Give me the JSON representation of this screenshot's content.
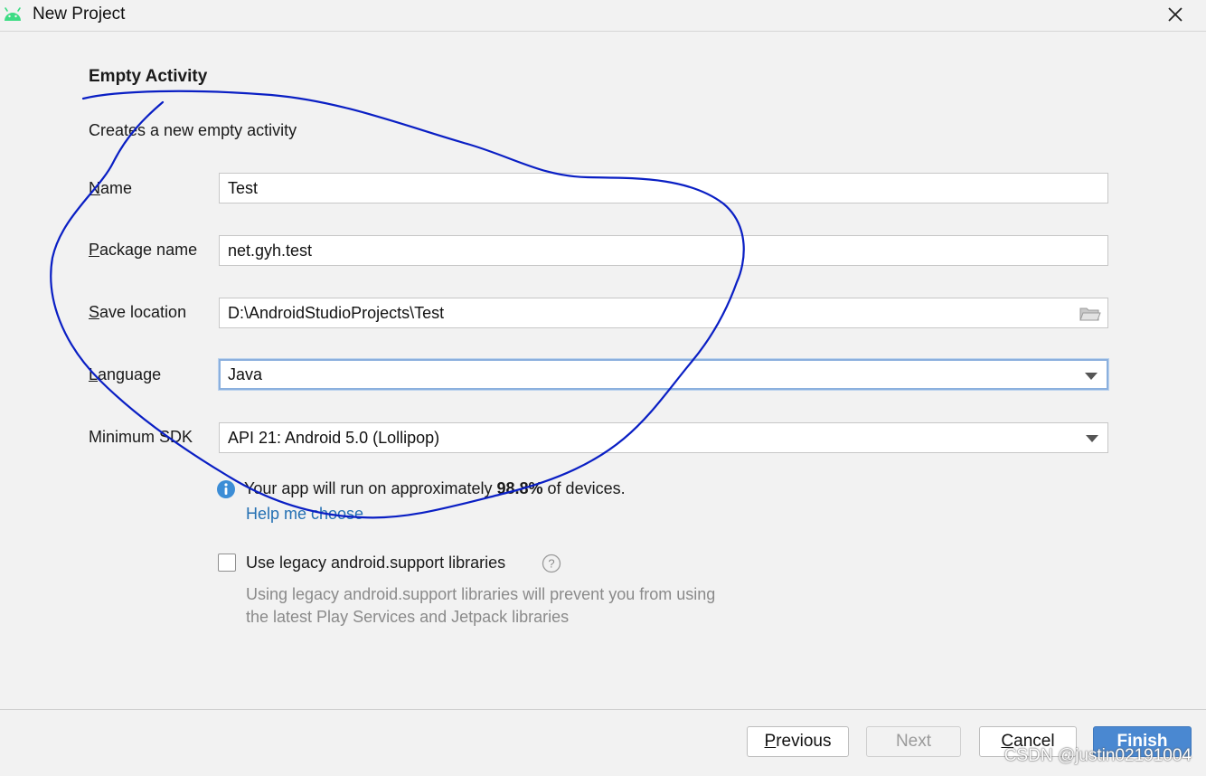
{
  "window": {
    "title": "New Project"
  },
  "template": {
    "heading": "Empty Activity",
    "description": "Creates a new empty activity"
  },
  "form": {
    "name": {
      "label_mnemonic": "N",
      "label_rest": "ame",
      "value": "Test"
    },
    "package": {
      "label_mnemonic": "P",
      "label_rest": "ackage name",
      "value": "net.gyh.test"
    },
    "save_location": {
      "label_mnemonic": "S",
      "label_rest": "ave location",
      "value": "D:\\AndroidStudioProjects\\Test"
    },
    "language": {
      "label_mnemonic": "L",
      "label_rest": "anguage",
      "value": "Java"
    },
    "min_sdk": {
      "label": "Minimum SDK",
      "value": "API 21: Android 5.0 (Lollipop)"
    }
  },
  "info": {
    "text_before": "Your app will run on approximately ",
    "percent": "98.8%",
    "text_after": " of devices.",
    "help_link": "Help me choose"
  },
  "legacy": {
    "checkbox_label": "Use legacy android.support libraries",
    "checked": false,
    "note_line1": "Using legacy android.support libraries will prevent you from using",
    "note_line2": "the latest Play Services and Jetpack libraries"
  },
  "buttons": {
    "previous_mnemonic": "P",
    "previous_rest": "revious",
    "next": "Next",
    "cancel_mnemonic": "C",
    "cancel_rest": "ancel",
    "finish": "Finish"
  },
  "watermark": "CSDN @justin02191004",
  "colors": {
    "accent": "#4a88d1",
    "link": "#2470b3",
    "android_green": "#3ddc84",
    "annotation_ink": "#0a1fc4"
  },
  "icons": [
    "android-logo-icon",
    "close-icon",
    "folder-icon",
    "chevron-down-icon",
    "info-icon",
    "help-icon"
  ]
}
